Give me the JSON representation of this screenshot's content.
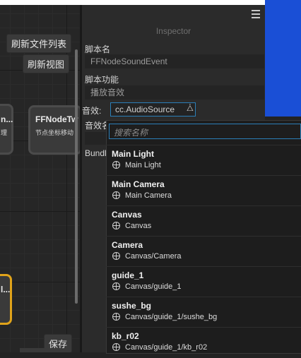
{
  "graph": {
    "refresh_files_label": "刷新文件列表",
    "refresh_view_label": "刷新视图",
    "save_label": "保存",
    "node_left": {
      "title": "n...",
      "subtitle": "理"
    },
    "node_right": {
      "title": "FFNodeTw",
      "subtitle": "节点坐标移动"
    },
    "node_bottom": {
      "title": "l..."
    }
  },
  "inspector": {
    "title": "Inspector",
    "script_name_label": "脚本名",
    "script_name_value": "FFNodeSoundEvent",
    "script_func_label": "脚本功能",
    "script_func_value": "播放音效",
    "sound_label": "音效:",
    "sound_value": "cc.AudioSource",
    "sound_name_label": "音效名",
    "bundle_label": "Bundl"
  },
  "dropdown": {
    "search_placeholder": "搜索名称",
    "items": [
      {
        "name": "Main Light",
        "path": "Main Light"
      },
      {
        "name": "Main Camera",
        "path": "Main Camera"
      },
      {
        "name": "Canvas",
        "path": "Canvas"
      },
      {
        "name": "Camera",
        "path": "Canvas/Camera"
      },
      {
        "name": "guide_1",
        "path": "Canvas/guide_1"
      },
      {
        "name": "sushe_bg",
        "path": "Canvas/guide_1/sushe_bg"
      },
      {
        "name": "kb_r02",
        "path": "Canvas/guide_1/kb_r02"
      }
    ]
  },
  "colors": {
    "accent": "#2b7fb8",
    "background_blue": "#1a4fd6",
    "node_highlight": "#e0a31a"
  }
}
